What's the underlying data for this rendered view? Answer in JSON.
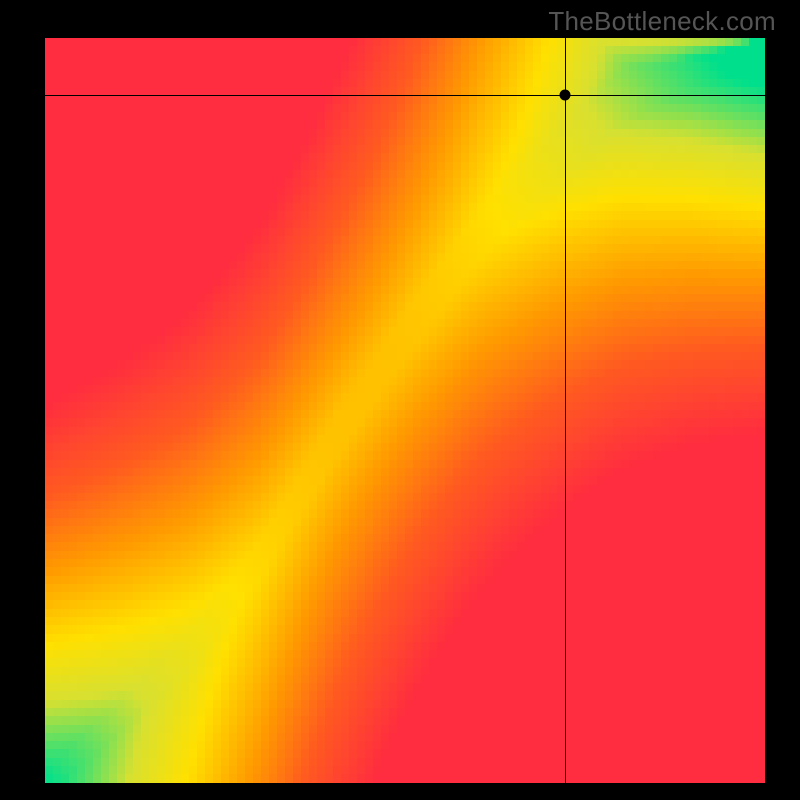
{
  "watermark": "TheBottleneck.com",
  "chart_data": {
    "type": "heatmap",
    "title": "",
    "xlabel": "",
    "ylabel": "",
    "xlim": [
      0,
      1
    ],
    "ylim": [
      0,
      1
    ],
    "grid": false,
    "legend": false,
    "marker": {
      "x": 0.722,
      "y": 0.924
    },
    "crosshair": {
      "x": 0.722,
      "y": 0.924
    },
    "ideal_curve_description": "Green ridge of ideal x/y ratio running diagonally; gradient fades through yellow/orange to red away from ridge. Approximate ridge control points (x -> y along optimal curve):",
    "ideal_curve": [
      {
        "x": 0.0,
        "y": 0.0
      },
      {
        "x": 0.1,
        "y": 0.085
      },
      {
        "x": 0.2,
        "y": 0.175
      },
      {
        "x": 0.3,
        "y": 0.3
      },
      {
        "x": 0.4,
        "y": 0.46
      },
      {
        "x": 0.5,
        "y": 0.6
      },
      {
        "x": 0.6,
        "y": 0.73
      },
      {
        "x": 0.7,
        "y": 0.83
      },
      {
        "x": 0.8,
        "y": 0.92
      },
      {
        "x": 0.9,
        "y": 0.97
      },
      {
        "x": 1.0,
        "y": 1.0
      }
    ],
    "color_stops": [
      {
        "t": 0.0,
        "color": "#00e08c"
      },
      {
        "t": 0.1,
        "color": "#66e060"
      },
      {
        "t": 0.2,
        "color": "#d8e030"
      },
      {
        "t": 0.35,
        "color": "#ffe000"
      },
      {
        "t": 0.55,
        "color": "#ff9a00"
      },
      {
        "t": 0.75,
        "color": "#ff5a20"
      },
      {
        "t": 1.0,
        "color": "#ff2d3f"
      }
    ],
    "pixelation": 90
  }
}
